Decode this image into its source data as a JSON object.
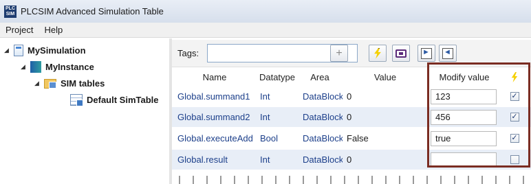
{
  "window": {
    "title": "PLCSIM Advanced Simulation Table",
    "app_icon_text": "PLC SIM"
  },
  "menu": {
    "items": [
      "Project",
      "Help"
    ]
  },
  "tree": {
    "nodes": [
      {
        "label": "MySimulation",
        "expanded": true,
        "icon": "simulation-file-icon"
      },
      {
        "label": "MyInstance",
        "expanded": true,
        "icon": "instance-icon"
      },
      {
        "label": "SIM tables",
        "expanded": true,
        "icon": "sim-tables-folder-icon"
      },
      {
        "label": "Default SimTable",
        "icon": "sim-table-icon"
      }
    ]
  },
  "toolbar": {
    "tags_label": "Tags:",
    "tags_value": "",
    "buttons": [
      "add-tag",
      "modify-all-selected",
      "load-project-tags",
      "import",
      "export"
    ]
  },
  "table": {
    "columns": [
      "Name",
      "Datatype",
      "Area",
      "Value",
      "Modify value"
    ],
    "rows": [
      {
        "name": "Global.summand1",
        "datatype": "Int",
        "area": "DataBlock",
        "value": "0",
        "modify": "123",
        "checked": true
      },
      {
        "name": "Global.summand2",
        "datatype": "Int",
        "area": "DataBlock",
        "value": "0",
        "modify": "456",
        "checked": true
      },
      {
        "name": "Global.executeAdd",
        "datatype": "Bool",
        "area": "DataBlock",
        "value": "False",
        "modify": "true",
        "checked": true
      },
      {
        "name": "Global.result",
        "datatype": "Int",
        "area": "DataBlock",
        "value": "0",
        "modify": "",
        "checked": false
      }
    ]
  },
  "colors": {
    "highlight_border": "#7a2c22",
    "name_text": "#1c3f8a",
    "row_alt": "#e8eef7"
  }
}
